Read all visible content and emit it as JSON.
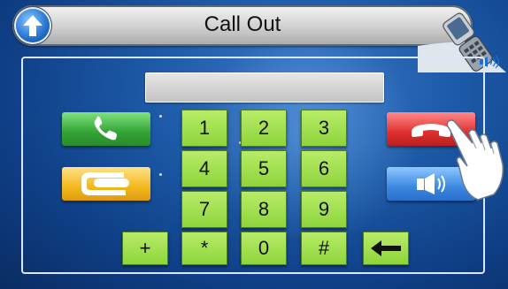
{
  "titlebar": {
    "title": "Call Out"
  },
  "display": {
    "value": ""
  },
  "keypad": {
    "row1": [
      "1",
      "2",
      "3"
    ],
    "row2": [
      "4",
      "5",
      "6"
    ],
    "row3": [
      "7",
      "8",
      "9"
    ],
    "row4": [
      "*",
      "0",
      "#"
    ],
    "plus": "+"
  },
  "icons": {
    "home": "up-arrow-circle-icon",
    "call": "phone-handset-icon",
    "hold": "phone-hold-icon",
    "hangup": "hang-up-icon",
    "speaker": "speaker-icon",
    "back": "backspace-arrow-icon",
    "device": "flip-phone-icon",
    "cursor": "pointing-hand-icon"
  },
  "colors": {
    "keypad": "#9ee04e",
    "call": "#34a336",
    "hold": "#f3b81c",
    "hangup": "#df3030",
    "speaker": "#3c88e0"
  }
}
